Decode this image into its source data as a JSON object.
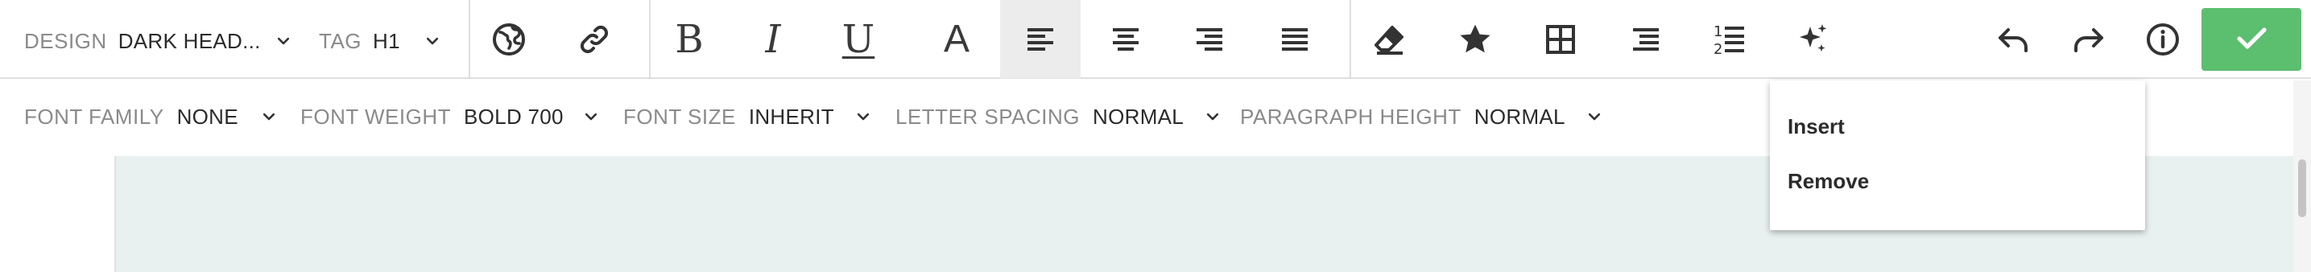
{
  "row1": {
    "design": {
      "label": "DESIGN",
      "value": "DARK HEAD..."
    },
    "tag": {
      "label": "TAG",
      "value": "H1"
    },
    "format": {
      "bold": "B",
      "italic": "I",
      "underline": "U",
      "color": "A"
    }
  },
  "row2": {
    "font_family": {
      "label": "FONT FAMILY",
      "value": "NONE"
    },
    "font_weight": {
      "label": "FONT WEIGHT",
      "value": "BOLD 700"
    },
    "font_size": {
      "label": "FONT SIZE",
      "value": "INHERIT"
    },
    "letter_spacing": {
      "label": "LETTER SPACING",
      "value": "NORMAL"
    },
    "paragraph_height": {
      "label": "PARAGRAPH HEIGHT",
      "value": "NORMAL"
    }
  },
  "dropdown": {
    "items": [
      {
        "label": "Insert"
      },
      {
        "label": "Remove"
      }
    ]
  },
  "icons": {
    "globe": "globe-icon",
    "link": "link-icon",
    "align_left": "align-left-icon",
    "align_center": "align-center-icon",
    "align_right": "align-right-icon",
    "justify": "align-justify-icon",
    "eraser": "eraser-icon",
    "star": "star-icon",
    "table": "table-icon",
    "bulleted_list": "bulleted-list-icon",
    "numbered_list": "numbered-list-icon",
    "sparkle": "sparkle-icon",
    "undo": "undo-icon",
    "redo": "redo-icon",
    "info": "info-icon",
    "check": "check-icon",
    "chevron": "chevron-down-icon"
  },
  "colors": {
    "confirm": "#5cbe6f",
    "active_bg": "#ececec",
    "canvas": "#e8f1f0",
    "label": "#8a8a8a",
    "value": "#2a2a2a",
    "icon": "#3a3a3a"
  }
}
